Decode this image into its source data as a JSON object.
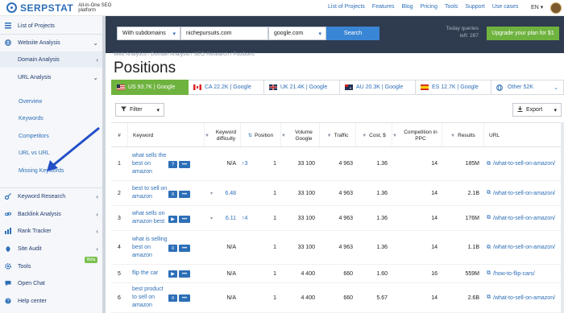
{
  "header": {
    "brand": "SERPSTAT",
    "tagline": "All-in-One SEO platform",
    "nav": [
      "List of Projects",
      "Features",
      "Blog",
      "Pricing",
      "Tools",
      "Support",
      "Use cases"
    ],
    "language": "EN"
  },
  "sidebar": {
    "items": [
      {
        "label": "List of Projects"
      },
      {
        "label": "Website Analysis"
      },
      {
        "label": "Domain Analysis"
      },
      {
        "label": "URL Analysis"
      },
      {
        "label": "Keyword Research"
      },
      {
        "label": "Backlink Analysis"
      },
      {
        "label": "Rank Tracker"
      },
      {
        "label": "Site Audit"
      },
      {
        "label": "Tools"
      },
      {
        "label": "Open Chat"
      },
      {
        "label": "Help center"
      }
    ],
    "url_subitems": [
      "Overview",
      "Keywords",
      "Competitors",
      "URL vs URL",
      "Missing Keywords"
    ],
    "beta_badge": "Beta"
  },
  "search": {
    "mode": "With subdomains",
    "query": "nichepursuits.com",
    "engine": "google.com",
    "button": "Search",
    "quota_line1": "Today queries",
    "quota_line2": "left: 287",
    "upgrade": "Upgrade your plan for $1"
  },
  "breadcrumbs": "Web Analytics / Domain Analysis / SEO Research / Positions",
  "page_title": "Positions",
  "db_tabs": [
    {
      "label": "US 93.7K | Google",
      "flag": "us"
    },
    {
      "label": "CA 22.2K | Google",
      "flag": "ca"
    },
    {
      "label": "UK 21.4K | Google",
      "flag": "uk"
    },
    {
      "label": "AU 20.3K | Google",
      "flag": "au"
    },
    {
      "label": "ES 12.7K | Google",
      "flag": "es"
    },
    {
      "label": "Other 52K",
      "flag": "globe"
    }
  ],
  "toolbar": {
    "filter": "Filter",
    "export": "Export"
  },
  "table": {
    "headers": {
      "num": "#",
      "keyword": "Keyword",
      "difficulty": "Keyword difficulty",
      "position": "Position",
      "volume": "Volume Google",
      "traffic": "Traffic",
      "cost": "Cost, $",
      "competition": "Competition in PPC",
      "results": "Results",
      "url": "URL"
    },
    "rows": [
      {
        "num": "1",
        "keyword": "what sells the best on amazon",
        "difficulty": "N/A",
        "trend": "3",
        "position": "1",
        "volume": "33 100",
        "traffic": "4 963",
        "cost": "1.36",
        "competition": "14",
        "results": "185M",
        "url": "/what-to-sell-on-amazon/"
      },
      {
        "num": "2",
        "keyword": "best to sell on amazon",
        "difficulty": "6.48",
        "trend": "",
        "position": "1",
        "volume": "33 100",
        "traffic": "4 963",
        "cost": "1.36",
        "competition": "14",
        "results": "2.1B",
        "url": "/what-to-sell-on-amazon/"
      },
      {
        "num": "3",
        "keyword": "what sells on amazon best",
        "difficulty": "6.11",
        "trend": "4",
        "position": "1",
        "volume": "33 100",
        "traffic": "4 963",
        "cost": "1.36",
        "competition": "14",
        "results": "176M",
        "url": "/what-to-sell-on-amazon/"
      },
      {
        "num": "4",
        "keyword": "what is selling best on amazon",
        "difficulty": "N/A",
        "trend": "",
        "position": "1",
        "volume": "33 100",
        "traffic": "4 963",
        "cost": "1.36",
        "competition": "14",
        "results": "1.1B",
        "url": "/what-to-sell-on-amazon/"
      },
      {
        "num": "5",
        "keyword": "flip the car",
        "difficulty": "N/A",
        "trend": "",
        "position": "1",
        "volume": "4 400",
        "traffic": "660",
        "cost": "1.60",
        "competition": "16",
        "results": "559M",
        "url": "/how-to-flip-cars/"
      },
      {
        "num": "6",
        "keyword": "best product to sell on amazon",
        "difficulty": "N/A",
        "trend": "",
        "position": "1",
        "volume": "4 400",
        "traffic": "660",
        "cost": "5.67",
        "competition": "14",
        "results": "2.6B",
        "url": "/what-to-sell-on-amazon/"
      }
    ]
  },
  "colors": {
    "brand_blue": "#2d6fb7",
    "active_green": "#6fb33f",
    "search_strip": "#2f3b4f",
    "annotation_arrow": "#2350c8"
  }
}
